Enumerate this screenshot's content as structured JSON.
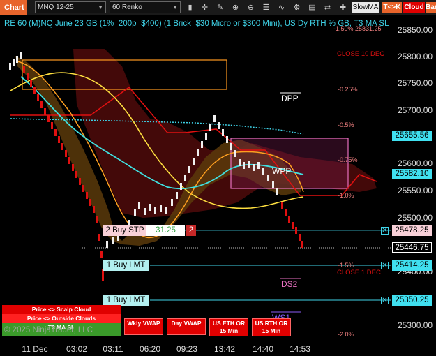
{
  "toolbar": {
    "chart_tab": "Chart",
    "instrument": "MNQ 12-25",
    "bar_type": "60 Renko",
    "indicator_select": "SlowMA",
    "tick_button": "T<>K",
    "cloud_button": "Cloud",
    "bar_button": "Bar",
    "icons": [
      "chevron-down-icon",
      "crosshair-icon",
      "pencil-icon",
      "zoom-icon",
      "zoom-out-icon",
      "properties-icon",
      "indicators-icon",
      "strategies-icon",
      "templates-icon",
      "sync-icon",
      "drawing-tools-icon"
    ]
  },
  "chart": {
    "title": "RE 60 (M)NQ June 23 GB (1%=200p=$400) (1 Brick=$30 Micro or $300 Mini), US Dy RTH % GB, T3 MA SL",
    "labels": {
      "close_10_dec": "CLOSE 10 DEC",
      "close_1_dec": "CLOSE 1 DEC",
      "dpp": "DPP",
      "wpp": "WPP",
      "ds2": "DS2",
      "ws1": "WS1",
      "pct_top": "-1.50% 25831.25",
      "pct_025": "-0.25%",
      "pct_05": "-0.5%",
      "pct_075": "-0.75%",
      "pct_10": "-1.0%",
      "pct_15": "-1.5%",
      "pct_20": "-2.0%"
    },
    "orders": {
      "buy_stp": "2 Buy STP",
      "buy_stp_price": "31.25",
      "buy_stp_qty": "2",
      "buy_lmt_1": "1 Buy LMT",
      "buy_lmt_2": "1 Buy LMT"
    },
    "copyright": "© 2025 NinjaTrader, LLC",
    "colors": {
      "accent_cyan": "#3fd3e8",
      "red_band": "#e01010",
      "orange": "#ffa020",
      "yellow": "#ffe040",
      "pink_box": "#e870c0",
      "orange_box": "#ff9a20"
    }
  },
  "price_axis": {
    "ticks": [
      "25850.00",
      "25800.00",
      "25750.00",
      "25700.00",
      "25650.00",
      "25600.00",
      "25550.00",
      "25500.00",
      "25450.00",
      "25400.00",
      "25350.00",
      "25300.00"
    ],
    "boxes": {
      "cyan_1": "25655.56",
      "cyan_2": "25582.10",
      "buy_stp": "25478.25",
      "last": "25446.75",
      "buy_lmt_1": "25414.25",
      "buy_lmt_2": "25350.25"
    }
  },
  "time_axis": {
    "ticks": [
      "11 Dec",
      "03:02",
      "03:11",
      "06:20",
      "09:23",
      "13:42",
      "14:40",
      "14:53"
    ]
  },
  "panel_buttons": {
    "scalp_cloud": "Price <> Scalp Cloud",
    "outside_clouds": "Price <> Outside Clouds",
    "t3_ma_sl": "T3 MA SL",
    "wkly_vwap": "Wkly VWAP",
    "day_vwap": "Day VWAP",
    "us_eth": "US ETH OR 15 Min",
    "us_rth": "US RTH OR 15 Min"
  }
}
